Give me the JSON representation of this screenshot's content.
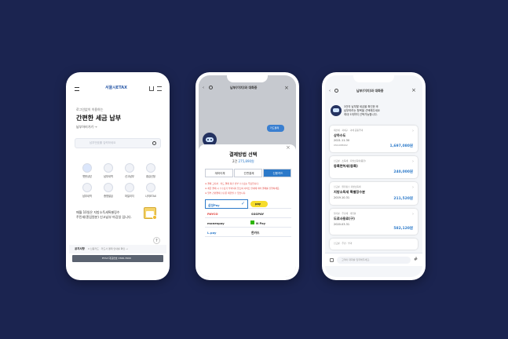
{
  "phone1": {
    "brand": "서울시ETAX",
    "intro": "로그인없이 이용하는",
    "headline": "간편한 세금 납부",
    "sub_link": "납부하러가기",
    "search_placeholder": "납부번호를 입력하세요",
    "menu": [
      "챗봇상담",
      "납부내역",
      "신고납부",
      "환급신청",
      "납부내역",
      "증명발급",
      "마일리지",
      "나의ETAX"
    ],
    "promo": "매월 10일은 지방소득세특별징수\n주민세(종업원분) 신고납부 마감일 입니다.",
    "notice_label": "공지사항",
    "notice_text": "0 신용카드 · 카드사 결제 안내를 확인 →",
    "bottom_text": "ETAX 대표번호 1566-3900"
  },
  "phone2": {
    "header_title": "납부(이지)와 대화중",
    "chat_bubble": "카드결제",
    "sheet_title": "결제방법 선택",
    "sheet_count": "2건",
    "sheet_amount": "275,890원",
    "tabs": [
      "계좌이체",
      "간편결제",
      "신용카드"
    ],
    "notes": [
      "※ 결제 고지서 · 카드 결제 회신 납부 수수료는 무료입니다.",
      "※ 세금 결제 시 수수료가 부과되지 않으며 사이트 안내에 따라 결제를 진행하세요.",
      "※ 일부 간편결제 수단은 제한될 수 있습니다."
    ],
    "pay_rows": [
      [
        "삼성Pay",
        "카카오Pay"
      ],
      [
        "PAYCO",
        "SSGPAY"
      ],
      [
        "monespay",
        "N Pay"
      ],
      [
        "L.pay",
        "한카드"
      ]
    ],
    "kakao_label": "pay"
  },
  "phone3": {
    "header_title": "납부(이지)와 대화중",
    "bot_message": "3건의 납부할 세금을 확인한 후\n납부하려는 항목을 선택해주세요\n최대 5개까지 선택가능합니다.",
    "cards": [
      {
        "tags": "재산세 · 과세구 · 과세 공동주택",
        "title": "상하수도",
        "date": "2021.11.30",
        "code": "0321085002",
        "amount": "1,697,080원"
      },
      {
        "tags": "신고분 · 소득세 · 지방소득세(종합)",
        "title": "등록면허세(등록)",
        "date": "",
        "code": "",
        "amount": "240,000원"
      },
      {
        "tags": "신고분 · 원천징수 지방소득세",
        "title": "지방소득세 특별징수분",
        "date": "2019.10.31",
        "code": "",
        "amount": "211,520원"
      },
      {
        "tags": "월기분 · 주민세 · 개인분",
        "title": "도로사용료(구)",
        "date": "2020.03.31",
        "code": "",
        "amount": "582,120원"
      },
      {
        "tags": "신고분 · 주민 · 부과",
        "title": "",
        "date": "",
        "code": "",
        "amount": ""
      }
    ],
    "input_placeholder": "고객이 대화를 입력해주세요."
  },
  "colors": {
    "background": "#1b2450",
    "accent": "#2b79c9",
    "red": "#e0403a",
    "gold": "#f0b92d"
  }
}
